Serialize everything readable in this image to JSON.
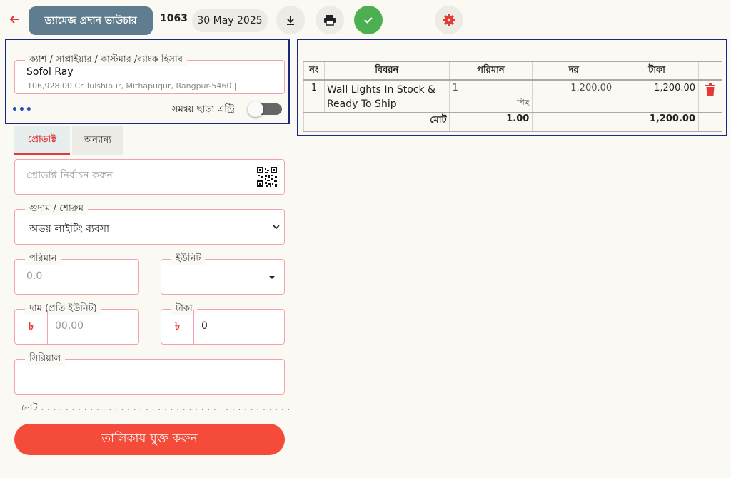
{
  "header": {
    "title": "ড্যামেজ প্রদান ভাউচার",
    "voucher_no": "1063",
    "date": "30 May 2025"
  },
  "icons": {
    "back": "arrow-left-icon",
    "download": "download-icon",
    "print": "print-icon",
    "confirm": "check-icon",
    "settings": "gear-icon"
  },
  "colors": {
    "accent": "#e53935",
    "title_bg": "#5f7d8f",
    "confirm_bg": "#4caf50",
    "add_button_bg": "#f44b3b",
    "highlight_border": "#1a2a7a"
  },
  "account": {
    "legend": "ক্যাশ / সাপ্লাইয়ার / কাস্টমার /ব্যাংক হিসাব",
    "name": "Sofol Ray",
    "details": "106,928.00 Cr Tulshipur, Mithapuqur, Rangpur-5460 |",
    "more": "•••",
    "toggle_label": "সমন্বয় ছাড়া এন্ট্রি",
    "toggle_on": false
  },
  "tabs": [
    {
      "label": "প্রোডাক্ট",
      "active": true
    },
    {
      "label": "অন্যান্য",
      "active": false
    }
  ],
  "form": {
    "product_placeholder": "প্রোডাক্ট নির্বাচন করুন",
    "warehouse_legend": "গুদাম / শোরুম",
    "warehouse_value": "অভয় লাইটিং ব্যবসা",
    "qty_legend": "পরিমান",
    "qty_placeholder": "0.0",
    "unit_legend": "ইউনিট",
    "unit_value": "",
    "price_legend": "দাম (প্রতি ইউনিট)",
    "price_placeholder": "00,00",
    "amount_legend": "টাকা",
    "amount_value": "0",
    "currency_symbol": "৳",
    "serial_legend": "সিরিয়াল",
    "note_label": "নোট . . . . . . . . . . . . . . . . . . . . . . . . . . . . . . . . . . . . . . . . .",
    "add_button": "তালিকায় যুক্ত করুন"
  },
  "table": {
    "headers": [
      "নং",
      "বিবরন",
      "পরিমান",
      "দর",
      "টাকা"
    ],
    "rows": [
      {
        "no": "1",
        "description": "Wall Lights In Stock & Ready To Ship",
        "qty": "1",
        "unit": "পিছ",
        "rate": "1,200.00",
        "amount": "1,200.00"
      }
    ],
    "total_label": "মোট",
    "total_qty": "1.00",
    "total_amount": "1,200.00"
  }
}
